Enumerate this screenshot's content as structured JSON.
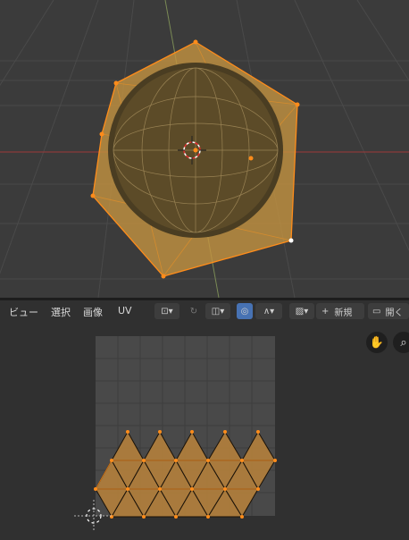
{
  "viewport3d": {
    "background": "#3b3b3b",
    "object_name": "icosphere",
    "object_color": "#d9a34a"
  },
  "uv_editor": {
    "menu": {
      "view": "ビュー",
      "select": "選択",
      "image": "画像",
      "uv": "UV"
    },
    "new_button": "新規",
    "open_button": "開く",
    "icons": {
      "pivot": "pivot-icon",
      "sync": "sync-selection-icon",
      "snap": "snap-icon",
      "proportional": "proportional-editing-icon",
      "falloff": "falloff-curve-icon",
      "image_browse": "image-browse-icon",
      "hand": "hand-pan-icon",
      "zoom": "zoom-icon"
    },
    "colors": {
      "accent": "#4772b3",
      "selection": "#ff8c1a",
      "face_fill": "#b4803c"
    }
  }
}
